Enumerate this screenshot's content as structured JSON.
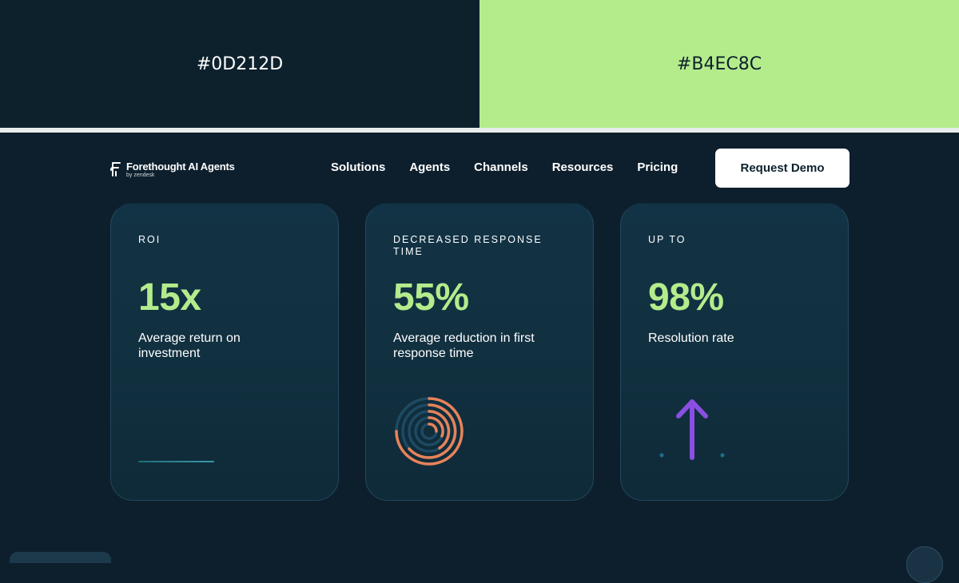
{
  "swatches": {
    "dark": {
      "label": "#0D212D",
      "color": "#0D212D"
    },
    "light": {
      "label": "#B4EC8C",
      "color": "#B4EC8C"
    }
  },
  "nav": {
    "logo": {
      "title": "Forethought AI Agents",
      "subtitle": "by zendesk"
    },
    "links": [
      "Solutions",
      "Agents",
      "Channels",
      "Resources",
      "Pricing"
    ],
    "cta_label": "Request Demo"
  },
  "cards": [
    {
      "label": "ROI",
      "stat": "15x",
      "description": "Average return on investment",
      "graphic": "line-icon"
    },
    {
      "label": "DECREASED RESPONSE TIME",
      "stat": "55%",
      "description": "Average reduction in first response time",
      "graphic": "concentric-rings-icon"
    },
    {
      "label": "UP TO",
      "stat": "98%",
      "description": "Resolution rate",
      "graphic": "arrow-up-icon"
    }
  ],
  "colors": {
    "background": "#0D1F2D",
    "accent_green": "#B4EC8C",
    "ring_orange": "#E8825A",
    "ring_blue": "#1E4A63",
    "arrow_purple": "#8A4FE0"
  }
}
